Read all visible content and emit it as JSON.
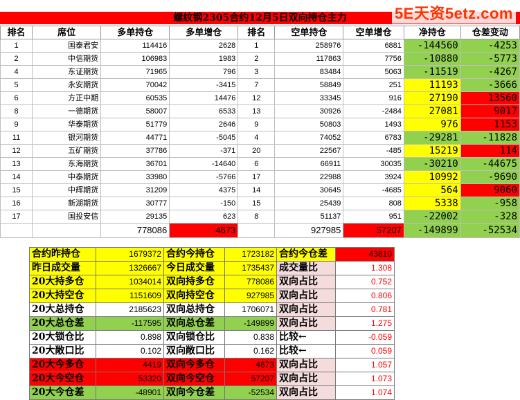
{
  "title": "螺纹钢2305合约12月5日双向持仓主力",
  "watermark": "5E天资5etz.com",
  "colors": {
    "yellow": "#ffff00",
    "red": "#ff0000",
    "green": "#92d050",
    "pink": "#f4dcdc"
  },
  "headers": [
    "排名",
    "席位",
    "多单持仓",
    "多单增仓",
    "排名",
    "空单持仓",
    "空单增仓",
    "净持仓",
    "仓差变动"
  ],
  "rows": [
    {
      "rank": "1",
      "seat": "国泰君安",
      "long": "114416",
      "long_chg": "2628",
      "srank": "1",
      "short": "258976",
      "short_chg": "6881",
      "net": "-144560",
      "net_c": "g",
      "diff": "-4253",
      "diff_c": "g"
    },
    {
      "rank": "2",
      "seat": "中信期货",
      "long": "106983",
      "long_chg": "1983",
      "srank": "2",
      "short": "117863",
      "short_chg": "7756",
      "net": "-10880",
      "net_c": "g",
      "diff": "-5773",
      "diff_c": "g"
    },
    {
      "rank": "4",
      "seat": "东证期货",
      "long": "71965",
      "long_chg": "796",
      "srank": "3",
      "short": "83484",
      "short_chg": "5063",
      "net": "-11519",
      "net_c": "g",
      "diff": "-4267",
      "diff_c": "g"
    },
    {
      "rank": "5",
      "seat": "永安期货",
      "long": "70042",
      "long_chg": "-3415",
      "srank": "7",
      "short": "58849",
      "short_chg": "251",
      "net": "11193",
      "net_c": "y",
      "diff": "-3666",
      "diff_c": "g"
    },
    {
      "rank": "6",
      "seat": "方正中期",
      "long": "60535",
      "long_chg": "14476",
      "srank": "12",
      "short": "33345",
      "short_chg": "916",
      "net": "27190",
      "net_c": "y",
      "diff": "13560",
      "diff_c": "rd"
    },
    {
      "rank": "8",
      "seat": "一德期货",
      "long": "58007",
      "long_chg": "6533",
      "srank": "13",
      "short": "30926",
      "short_chg": "-2484",
      "net": "27081",
      "net_c": "y",
      "diff": "9017",
      "diff_c": "rd"
    },
    {
      "rank": "9",
      "seat": "华泰期货",
      "long": "51779",
      "long_chg": "2646",
      "srank": "9",
      "short": "50803",
      "short_chg": "1493",
      "net": "976",
      "net_c": "y",
      "diff": "1153",
      "diff_c": "rd"
    },
    {
      "rank": "11",
      "seat": "银河期货",
      "long": "44771",
      "long_chg": "-5045",
      "srank": "4",
      "short": "74052",
      "short_chg": "6783",
      "net": "-29281",
      "net_c": "g",
      "diff": "-11828",
      "diff_c": "g"
    },
    {
      "rank": "12",
      "seat": "五矿期货",
      "long": "37786",
      "long_chg": "-371",
      "srank": "20",
      "short": "22567",
      "short_chg": "-485",
      "net": "15219",
      "net_c": "y",
      "diff": "114",
      "diff_c": "rd"
    },
    {
      "rank": "13",
      "seat": "东海期货",
      "long": "36701",
      "long_chg": "-14640",
      "srank": "6",
      "short": "66911",
      "short_chg": "30035",
      "net": "-30210",
      "net_c": "g",
      "diff": "-44675",
      "diff_c": "g"
    },
    {
      "rank": "14",
      "seat": "中泰期货",
      "long": "33980",
      "long_chg": "-5766",
      "srank": "17",
      "short": "22988",
      "short_chg": "3924",
      "net": "10992",
      "net_c": "y",
      "diff": "-9690",
      "diff_c": "g"
    },
    {
      "rank": "15",
      "seat": "中辉期货",
      "long": "31209",
      "long_chg": "4375",
      "srank": "14",
      "short": "30645",
      "short_chg": "-4685",
      "net": "564",
      "net_c": "y",
      "diff": "9060",
      "diff_c": "rd"
    },
    {
      "rank": "16",
      "seat": "新湖期货",
      "long": "30777",
      "long_chg": "-150",
      "srank": "15",
      "short": "25439",
      "short_chg": "808",
      "net": "5338",
      "net_c": "y",
      "diff": "-958",
      "diff_c": "g"
    },
    {
      "rank": "17",
      "seat": "国投安信",
      "long": "29135",
      "long_chg": "623",
      "srank": "8",
      "short": "51137",
      "short_chg": "951",
      "net": "-22002",
      "net_c": "g",
      "diff": "-328",
      "diff_c": "g"
    }
  ],
  "totals": {
    "long": "778086",
    "long_chg": "4673",
    "short": "927985",
    "short_chg": "57207",
    "net": "-149899",
    "diff": "-52534"
  },
  "summary": [
    [
      {
        "t": "合约昨持仓",
        "c": "y",
        "k": "lbl"
      },
      {
        "t": "1679372",
        "c": "y",
        "k": "num"
      },
      {
        "t": "合约今持仓",
        "c": "y",
        "k": "lbl"
      },
      {
        "t": "1723182",
        "c": "y",
        "k": "num"
      },
      {
        "t": "合约今仓差",
        "c": "y",
        "k": "lbl"
      },
      {
        "t": "43810",
        "c": "rd",
        "k": "num"
      }
    ],
    [
      {
        "t": "昨日成交量",
        "c": "y",
        "k": "lbl"
      },
      {
        "t": "1326667",
        "c": "y",
        "k": "num"
      },
      {
        "t": "今日成交量",
        "c": "y",
        "k": "lbl"
      },
      {
        "t": "1735437",
        "c": "y",
        "k": "num"
      },
      {
        "t": "成交量比",
        "c": "pk",
        "k": "lbl"
      },
      {
        "t": "1.308",
        "c": "",
        "k": "rnum"
      }
    ],
    [
      {
        "t": "20大持多仓",
        "c": "y",
        "k": "lbl"
      },
      {
        "t": "1034014",
        "c": "y",
        "k": "num"
      },
      {
        "t": "双向持多仓",
        "c": "y",
        "k": "lbl"
      },
      {
        "t": "778086",
        "c": "y",
        "k": "num"
      },
      {
        "t": "双向占比",
        "c": "pk",
        "k": "lbl"
      },
      {
        "t": "0.752",
        "c": "",
        "k": "rnum"
      }
    ],
    [
      {
        "t": "20大持空仓",
        "c": "y",
        "k": "lbl"
      },
      {
        "t": "1151609",
        "c": "y",
        "k": "num"
      },
      {
        "t": "双向持空仓",
        "c": "y",
        "k": "lbl"
      },
      {
        "t": "927985",
        "c": "y",
        "k": "num"
      },
      {
        "t": "双向占比",
        "c": "pk",
        "k": "lbl"
      },
      {
        "t": "0.806",
        "c": "",
        "k": "rnum"
      }
    ],
    [
      {
        "t": "20大总持仓",
        "c": "",
        "k": "lbl"
      },
      {
        "t": "2185623",
        "c": "",
        "k": "num"
      },
      {
        "t": "双向总持仓",
        "c": "",
        "k": "lbl"
      },
      {
        "t": "1706071",
        "c": "",
        "k": "num"
      },
      {
        "t": "双向占比",
        "c": "pk",
        "k": "lbl"
      },
      {
        "t": "0.781",
        "c": "",
        "k": "rnum"
      }
    ],
    [
      {
        "t": "20大总仓差",
        "c": "g",
        "k": "lbl"
      },
      {
        "t": "-117595",
        "c": "g",
        "k": "num"
      },
      {
        "t": "双向总仓差",
        "c": "g",
        "k": "lbl"
      },
      {
        "t": "-149899",
        "c": "g",
        "k": "num"
      },
      {
        "t": "双向占比",
        "c": "pk",
        "k": "lbl"
      },
      {
        "t": "1.275",
        "c": "",
        "k": "rnum"
      }
    ],
    [
      {
        "t": "20大锁仓比",
        "c": "",
        "k": "lbl"
      },
      {
        "t": "0.898",
        "c": "",
        "k": "num"
      },
      {
        "t": "双向锁仓比",
        "c": "",
        "k": "lbl"
      },
      {
        "t": "0.838",
        "c": "",
        "k": "num"
      },
      {
        "t": "比较←",
        "c": "",
        "k": "lbl"
      },
      {
        "t": "-0.059",
        "c": "",
        "k": "rnum"
      }
    ],
    [
      {
        "t": "20大敞口比",
        "c": "",
        "k": "lbl"
      },
      {
        "t": "0.102",
        "c": "",
        "k": "num"
      },
      {
        "t": "双向敞口比",
        "c": "",
        "k": "lbl"
      },
      {
        "t": "0.162",
        "c": "",
        "k": "num"
      },
      {
        "t": "比较←",
        "c": "",
        "k": "lbl"
      },
      {
        "t": "0.059",
        "c": "",
        "k": "rnum"
      }
    ],
    [
      {
        "t": "20大今多仓",
        "c": "rd",
        "k": "lbl"
      },
      {
        "t": "4419",
        "c": "rd",
        "k": "num"
      },
      {
        "t": "双向今多仓",
        "c": "rd",
        "k": "lbl"
      },
      {
        "t": "4673",
        "c": "rd",
        "k": "num"
      },
      {
        "t": "双向占比",
        "c": "pk",
        "k": "lbl"
      },
      {
        "t": "1.057",
        "c": "",
        "k": "rnum"
      }
    ],
    [
      {
        "t": "20大今空仓",
        "c": "rd",
        "k": "lbl"
      },
      {
        "t": "53320",
        "c": "rd",
        "k": "num"
      },
      {
        "t": "双向今空仓",
        "c": "rd",
        "k": "lbl"
      },
      {
        "t": "57207",
        "c": "rd",
        "k": "num"
      },
      {
        "t": "双向占比",
        "c": "pk",
        "k": "lbl"
      },
      {
        "t": "1.073",
        "c": "",
        "k": "rnum"
      }
    ],
    [
      {
        "t": "20大今仓差",
        "c": "g",
        "k": "lbl"
      },
      {
        "t": "-48901",
        "c": "g",
        "k": "num"
      },
      {
        "t": "双向今仓差",
        "c": "g",
        "k": "lbl"
      },
      {
        "t": "-52534",
        "c": "g",
        "k": "num"
      },
      {
        "t": "双向占比",
        "c": "pk",
        "k": "lbl"
      },
      {
        "t": "1.074",
        "c": "",
        "k": "rnum"
      }
    ]
  ]
}
